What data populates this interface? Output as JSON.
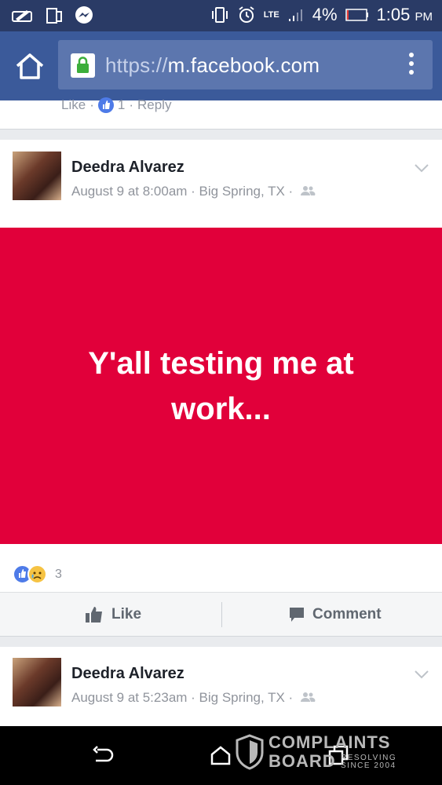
{
  "status_bar": {
    "battery": "4%",
    "time": "1:05",
    "ampm": "PM",
    "network": "LTE"
  },
  "browser": {
    "url_scheme": "https://",
    "url_host": "m.facebook.com"
  },
  "previous_comment": {
    "like_label": "Like",
    "separator1": "·",
    "like_count": "1",
    "separator2": "·",
    "reply_label": "Reply"
  },
  "post1": {
    "author": "Deedra Alvarez",
    "meta": "August 9 at 8:00am · Big Spring, TX ·",
    "text": "Y'all testing me at work...",
    "reaction_count": "3",
    "like_button": "Like",
    "comment_button": "Comment"
  },
  "post2": {
    "author": "Deedra Alvarez",
    "meta": "August 9 at 5:23am · Big Spring, TX ·"
  },
  "watermark": {
    "line1": "COMPLAINTS",
    "line2": "BOARD",
    "tagline1": "RESOLVING",
    "tagline2": "SINCE 2004"
  },
  "colors": {
    "status_bar": "#2a3b66",
    "browser_bar": "#3b5a9a",
    "banner": "#e1003a",
    "like_blue": "#4e7be8"
  }
}
